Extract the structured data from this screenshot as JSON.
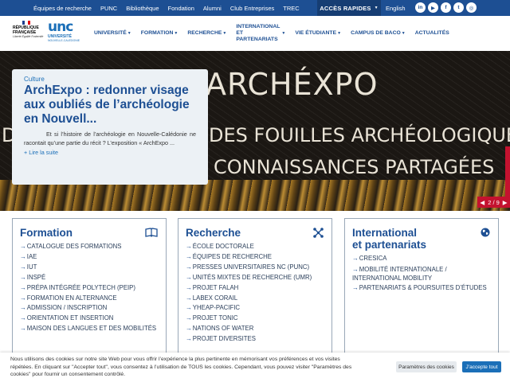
{
  "topbar": {
    "links": [
      "Équipes de recherche",
      "PUNC",
      "Bibliothèque",
      "Fondation",
      "Alumni",
      "Club Entreprises",
      "TREC"
    ],
    "acces_rapides": "ACCÈS RAPIDES",
    "lang": "English",
    "socials": [
      "in",
      "▶",
      "f",
      "t",
      "◎"
    ],
    "colors": {
      "bar": "#1d4f93",
      "acces": "#163d73"
    }
  },
  "header": {
    "rf_line1": "RÉPUBLIQUE",
    "rf_line2": "FRANÇAISE",
    "rf_motto": "Liberté Égalité Fraternité",
    "unc_logo": "unc",
    "unc_line1": "UNIVERSITÉ",
    "unc_line2": "NOUVELLE-CALÉDONIE",
    "nav": [
      {
        "label": "UNIVERSITÉ"
      },
      {
        "label": "FORMATION"
      },
      {
        "label": "RECHERCHE"
      },
      {
        "label": "INTERNATIONAL ET PARTENARIATS"
      },
      {
        "label": "VIE ÉTUDIANTE"
      },
      {
        "label": "CAMPUS DE BACO"
      },
      {
        "label": "ACTUALITÉS"
      }
    ]
  },
  "hero": {
    "bg_title": "ARCHÉXPO",
    "bg_line1_left": "D",
    "bg_line1": "DES FOUILLES ARCHÉOLOGIQUES",
    "bg_line2": "CONNAISSANCES PARTAGÉES",
    "card": {
      "category": "Culture",
      "title": "ArchExpo : redonner visage aux oubliés de l’archéologie en Nouvell...",
      "excerpt": "Et si l’histoire de l’archéologie en Nouvelle-Calédonie ne racontait qu’une partie du récit ? L’exposition « ArchExpo ...",
      "more": "+ Lire la suite"
    },
    "counter": "2 / 9",
    "accent": "#c4122f"
  },
  "boxes": [
    {
      "title": "Formation",
      "icon": "book-icon",
      "items": [
        "CATALOGUE DES FORMATIONS",
        "IAE",
        "IUT",
        "INSPÉ",
        "PRÉPA INTÉGRÉE POLYTECH (PEIP)",
        "FORMATION EN ALTERNANCE",
        "ADMISSION / INSCRIPTION",
        "ORIENTATION ET INSERTION",
        "MAISON DES LANGUES ET DES MOBILITÉS"
      ]
    },
    {
      "title": "Recherche",
      "icon": "network-icon",
      "items": [
        "ÉCOLE DOCTORALE",
        "ÉQUIPES DE RECHERCHE",
        "PRESSES UNIVERSITAIRES NC (PUNC)",
        "UNITÉS MIXTES DE RECHERCHE (UMR)",
        "PROJET FALAH",
        "LABEX CORAIL",
        "YHEAP-PACIFIC",
        "PROJET TONIC",
        "NATIONS OF WATER",
        "PROJET DIVERSITES"
      ]
    },
    {
      "title_line1": "International",
      "title_line2": "et partenariats",
      "icon": "globe-icon",
      "items": [
        "CRESICA",
        "MOBILITÉ INTERNATIONALE / INTERNATIONAL MOBILITY",
        "PARTENARIATS & POURSUITES D’ÉTUDES"
      ]
    }
  ],
  "cookie": {
    "text": "Nous utilisons des cookies sur notre site Web pour vous offrir l’expérience la plus pertinente en mémorisant vos préférences et vos visites répétées. En cliquant sur \"Accepter tout\", vous consentez à l’utilisation de TOUS les cookies. Cependant, vous pouvez visiter \"Paramètres des cookies\" pour fournir un consentement contrôlé.",
    "settings": "Paramètres des cookies",
    "accept": "J’accepte tout"
  }
}
